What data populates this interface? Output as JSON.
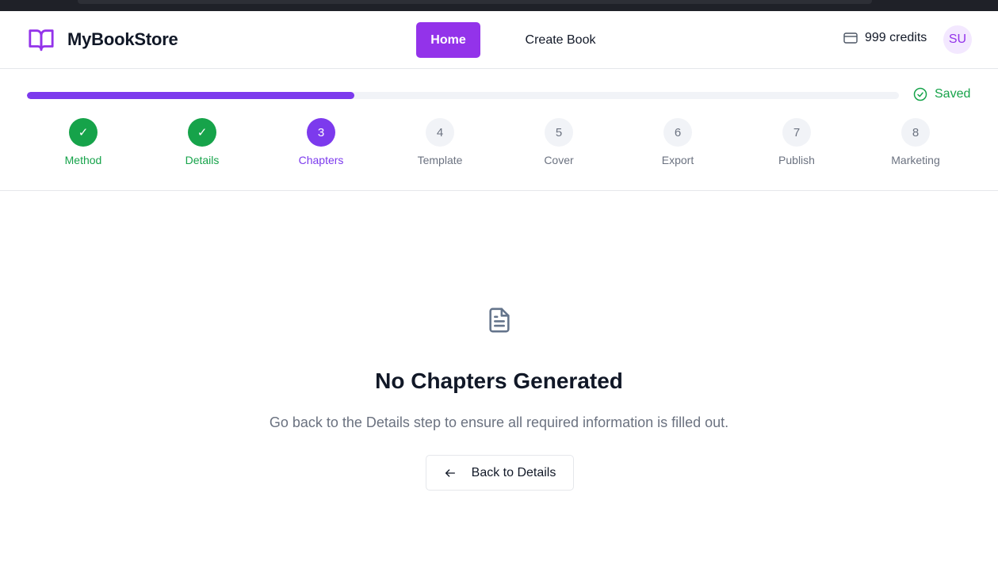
{
  "app": {
    "name": "MyBookStore",
    "logo_icon": "book-open-icon",
    "brand_color": "#9333ea"
  },
  "nav": {
    "home_label": "Home",
    "create_label": "Create Book"
  },
  "account": {
    "credits_label": "999 credits",
    "credits_icon": "credit-card-icon",
    "avatar_initials": "SU"
  },
  "progress": {
    "fraction": 0.375,
    "status_label": "Saved",
    "status_icon": "check-circle-icon"
  },
  "steps": [
    {
      "number": "1",
      "label": "Method",
      "state": "done",
      "mark": "✓"
    },
    {
      "number": "2",
      "label": "Details",
      "state": "done",
      "mark": "✓"
    },
    {
      "number": "3",
      "label": "Chapters",
      "state": "current",
      "mark": "3"
    },
    {
      "number": "4",
      "label": "Template",
      "state": "todo",
      "mark": "4"
    },
    {
      "number": "5",
      "label": "Cover",
      "state": "todo",
      "mark": "5"
    },
    {
      "number": "6",
      "label": "Export",
      "state": "todo",
      "mark": "6"
    },
    {
      "number": "7",
      "label": "Publish",
      "state": "todo",
      "mark": "7"
    },
    {
      "number": "8",
      "label": "Marketing",
      "state": "todo",
      "mark": "8"
    }
  ],
  "empty_state": {
    "icon": "file-text-icon",
    "title": "No Chapters Generated",
    "description": "Go back to the Details step to ensure all required information is filled out.",
    "button_label": "Back to Details",
    "button_icon": "arrow-left-icon"
  },
  "colors": {
    "done": "#16a34a",
    "current": "#7c3aed",
    "todo": "#6b7280"
  }
}
